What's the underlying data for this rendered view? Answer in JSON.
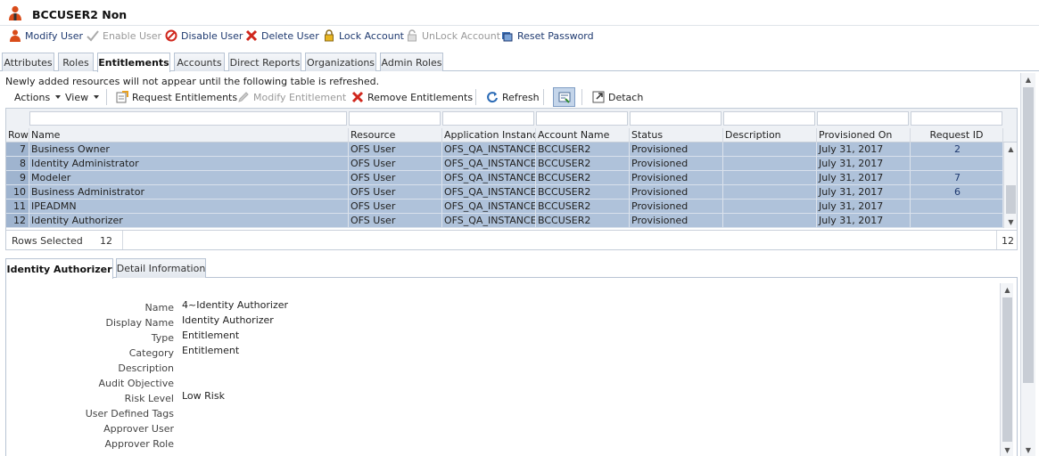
{
  "header": {
    "title": "BCCUSER2 Non",
    "icon": "user-icon"
  },
  "actions": [
    {
      "label": "Modify User",
      "icon": "user-edit-icon",
      "enabled": true
    },
    {
      "label": "Enable User",
      "icon": "check-icon",
      "enabled": false
    },
    {
      "label": "Disable User",
      "icon": "disable-icon",
      "enabled": true
    },
    {
      "label": "Delete User",
      "icon": "red-x-icon",
      "enabled": true
    },
    {
      "label": "Lock Account",
      "icon": "lock-icon",
      "enabled": true
    },
    {
      "label": "UnLock Account",
      "icon": "unlock-icon",
      "enabled": false
    },
    {
      "label": "Reset Password",
      "icon": "reset-password-icon",
      "enabled": true
    }
  ],
  "tabs": [
    "Attributes",
    "Roles",
    "Entitlements",
    "Accounts",
    "Direct Reports",
    "Organizations",
    "Admin Roles"
  ],
  "active_tab": "Entitlements",
  "notice": "Newly added resources will not appear until the following table is refreshed.",
  "table_toolbar": {
    "actions_menu": "Actions",
    "view_menu": "View",
    "request": "Request Entitlements",
    "modify": "Modify Entitlement",
    "remove": "Remove Entitlements",
    "refresh": "Refresh",
    "detach": "Detach"
  },
  "table": {
    "columns": [
      "Row",
      "Name",
      "Resource",
      "Application Instance",
      "Account Name",
      "Status",
      "Description",
      "Provisioned On",
      "Request ID"
    ],
    "rows": [
      {
        "row": "7",
        "name": "Business Owner",
        "resource": "OFS User",
        "app": "OFS_QA_INSTANCE",
        "account": "BCCUSER2",
        "status": "Provisioned",
        "description": "",
        "provisioned": "July 31, 2017",
        "request": "2"
      },
      {
        "row": "8",
        "name": "Identity Administrator",
        "resource": "OFS User",
        "app": "OFS_QA_INSTANCE",
        "account": "BCCUSER2",
        "status": "Provisioned",
        "description": "",
        "provisioned": "July 31, 2017",
        "request": ""
      },
      {
        "row": "9",
        "name": "Modeler",
        "resource": "OFS User",
        "app": "OFS_QA_INSTANCE",
        "account": "BCCUSER2",
        "status": "Provisioned",
        "description": "",
        "provisioned": "July 31, 2017",
        "request": "7"
      },
      {
        "row": "10",
        "name": "Business Administrator",
        "resource": "OFS User",
        "app": "OFS_QA_INSTANCE",
        "account": "BCCUSER2",
        "status": "Provisioned",
        "description": "",
        "provisioned": "July 31, 2017",
        "request": "6"
      },
      {
        "row": "11",
        "name": "IPEADMN",
        "resource": "OFS User",
        "app": "OFS_QA_INSTANCE",
        "account": "BCCUSER2",
        "status": "Provisioned",
        "description": "",
        "provisioned": "July 31, 2017",
        "request": ""
      },
      {
        "row": "12",
        "name": "Identity Authorizer",
        "resource": "OFS User",
        "app": "OFS_QA_INSTANCE",
        "account": "BCCUSER2",
        "status": "Provisioned",
        "description": "",
        "provisioned": "July 31, 2017",
        "request": ""
      }
    ],
    "footer": {
      "rows_selected_label": "Rows Selected",
      "rows_selected": "12",
      "total": "12"
    }
  },
  "detail_tabs": [
    "Identity Authorizer",
    "Detail Information"
  ],
  "detail": [
    {
      "label": "Name",
      "value": "4~Identity Authorizer"
    },
    {
      "label": "Display Name",
      "value": "Identity Authorizer"
    },
    {
      "label": "Type",
      "value": "Entitlement"
    },
    {
      "label": "Category",
      "value": "Entitlement"
    },
    {
      "label": "Description",
      "value": ""
    },
    {
      "label": "Audit Objective",
      "value": ""
    },
    {
      "label": "Risk Level",
      "value": "Low Risk"
    },
    {
      "label": "User Defined Tags",
      "value": ""
    },
    {
      "label": "Approver User",
      "value": ""
    },
    {
      "label": "Approver Role",
      "value": ""
    }
  ],
  "colors": {
    "selected_row": "#afc2da",
    "link": "#1f3a70",
    "accent_red": "#d0271d"
  }
}
